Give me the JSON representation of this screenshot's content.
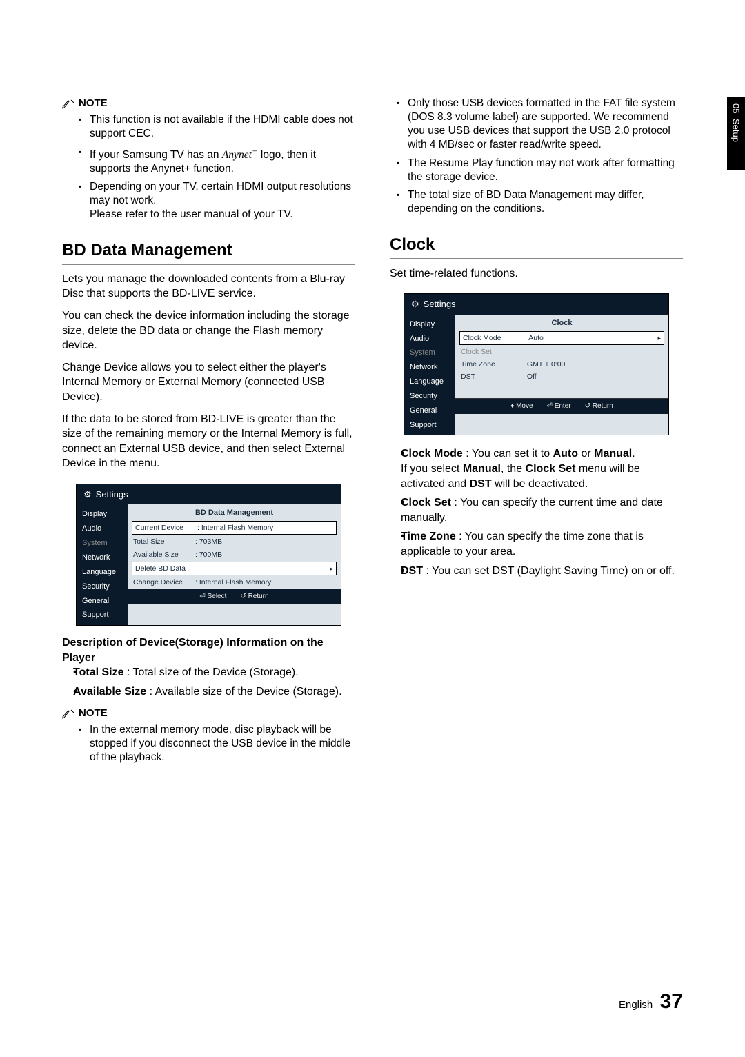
{
  "sideTab": {
    "num": "05",
    "word": "Setup"
  },
  "left": {
    "noteLabel": "NOTE",
    "noteItems": [
      "This function is not available if the HDMI cable does not support CEC.",
      "If your Samsung TV has an Anynet+ logo, then it supports the Anynet+ function.",
      "Depending on your TV, certain HDMI output resolutions may not work.\nPlease refer to the user manual of your TV."
    ],
    "bdHeading": "BD Data Management",
    "bdP1": "Lets you manage the downloaded contents from a Blu-ray Disc that supports the BD-LIVE service.",
    "bdP2": "You can check the device information including the storage size, delete the BD data or change the Flash memory device.",
    "bdP3": "Change Device allows you to select either the player's Internal Memory or External Memory (connected USB Device).",
    "bdP4": "If the data to be stored from BD-LIVE is greater than the size of the remaining memory or the Internal Memory is full, connect an External USB device, and then select External Device in the menu.",
    "bdScreenshot": {
      "settings": "Settings",
      "side": [
        "Display",
        "Audio",
        "System",
        "Network",
        "Language",
        "Security",
        "General",
        "Support"
      ],
      "title": "BD Data Management",
      "rows": [
        {
          "l": "Current Device",
          "v": ": Internal Flash Memory"
        },
        {
          "l": "Total Size",
          "v": ": 703MB"
        },
        {
          "l": "Available Size",
          "v": ": 700MB"
        },
        {
          "l": "Delete BD Data",
          "v": "",
          "arrow": "▸",
          "boxed": true
        },
        {
          "l": "Change Device",
          "v": ": Internal Flash Memory"
        }
      ],
      "footer": {
        "a": "Select",
        "b": "Return"
      }
    },
    "descHeading": "Description of Device(Storage) Information on the Player",
    "desc": [
      {
        "b": "Total Size",
        "t": " : Total size of the Device (Storage)."
      },
      {
        "b": "Available Size",
        "t": " : Available size of the Device (Storage)."
      }
    ],
    "note2Items": [
      "In the external memory mode, disc playback will be stopped if you disconnect the USB device in the middle of the playback."
    ]
  },
  "right": {
    "topItems": [
      "Only those USB devices formatted in the FAT file system (DOS 8.3 volume label) are supported. We recommend you use USB devices that support the USB 2.0 protocol with 4 MB/sec or faster read/write speed.",
      "The Resume Play function may not work after formatting the storage device.",
      "The total size of BD Data Management may differ, depending on the conditions."
    ],
    "clockHeading": "Clock",
    "clockIntro": "Set time-related functions.",
    "clockScreenshot": {
      "settings": "Settings",
      "side": [
        "Display",
        "Audio",
        "System",
        "Network",
        "Language",
        "Security",
        "General",
        "Support"
      ],
      "title": "Clock",
      "rows": [
        {
          "l": "Clock Mode",
          "v": ": Auto",
          "arrow": "▸",
          "boxed": true
        },
        {
          "l": "Clock Set",
          "v": "",
          "dim": true
        },
        {
          "l": "Time Zone",
          "v": ": GMT + 0:00"
        },
        {
          "l": "DST",
          "v": ": Off"
        }
      ],
      "footer": {
        "move": "Move",
        "enter": "Enter",
        "ret": "Return"
      }
    },
    "clockBullets": [
      {
        "pre": "Clock Mode",
        "mid": " : You can set it to ",
        "b2": "Auto",
        "mid2": " or ",
        "b3": "Manual",
        "tail": ".",
        "extra": "If you select Manual, the Clock Set menu will be activated and DST will be deactivated."
      },
      {
        "pre": "Clock Set",
        "tail": " : You can specify the current time and date manually."
      },
      {
        "pre": "Time Zone",
        "tail": " : You can specify the time zone that is applicable to your area."
      },
      {
        "pre": "DST",
        "tail": " : You can set DST (Daylight Saving Time) on or off."
      }
    ]
  },
  "footer": {
    "lang": "English",
    "page": "37"
  }
}
